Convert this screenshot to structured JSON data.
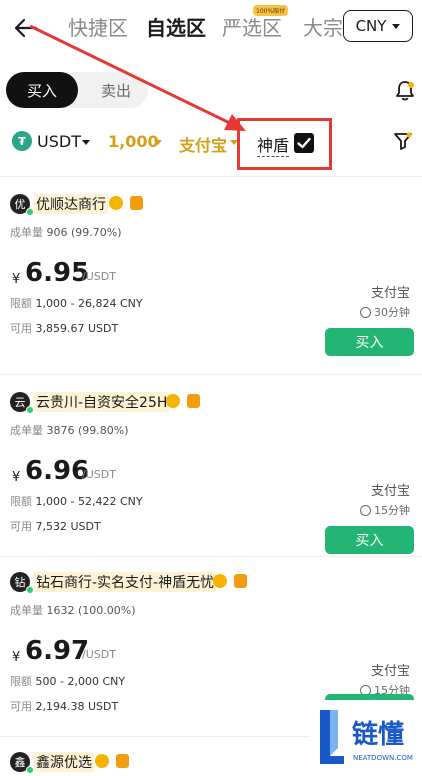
{
  "header": {
    "tabs": [
      {
        "label": "快捷区"
      },
      {
        "label": "自选区"
      },
      {
        "label": "严选区",
        "badge": "100%赔付"
      },
      {
        "label": "大宗"
      }
    ],
    "currency": "CNY"
  },
  "trade_toggle": {
    "buy": "买入",
    "sell": "卖出"
  },
  "filters": {
    "coin": "USDT",
    "amount": "1,000",
    "payment": "支付宝",
    "shield_label": "神盾",
    "shield_checked": true
  },
  "listings": [
    {
      "avatar": "优",
      "merchant": "优顺达商行",
      "orders_label": "成单量",
      "orders": "906 (99.70%)",
      "currency_symbol": "¥",
      "price": "6.95",
      "unit": "/USDT",
      "limit_label": "限额",
      "limit": "1,000 - 26,824 CNY",
      "avail_label": "可用",
      "available": "3,859.67 USDT",
      "payment": "支付宝",
      "time": "30分钟",
      "button": "买入"
    },
    {
      "avatar": "云",
      "merchant": "云贵川-自资安全25H",
      "orders_label": "成单量",
      "orders": "3876 (99.80%)",
      "currency_symbol": "¥",
      "price": "6.96",
      "unit": "/USDT",
      "limit_label": "限额",
      "limit": "1,000 - 52,422 CNY",
      "avail_label": "可用",
      "available": "7,532 USDT",
      "payment": "支付宝",
      "time": "15分钟",
      "button": "买入"
    },
    {
      "avatar": "钻",
      "merchant": "钻石商行-实名支付-神盾无忧",
      "orders_label": "成单量",
      "orders": "1632 (100.00%)",
      "currency_symbol": "¥",
      "price": "6.97",
      "unit": "/USDT",
      "limit_label": "限额",
      "limit": "500 - 2,000 CNY",
      "avail_label": "可用",
      "available": "2,194.38 USDT",
      "payment": "支付宝",
      "time": "15分钟",
      "button": "买入"
    },
    {
      "avatar": "鑫",
      "merchant": "鑫源优选"
    }
  ],
  "watermark": {
    "text": "链懂",
    "sub": "NEATDOWN.COM"
  },
  "colors": {
    "accent": "#d4a017",
    "buy": "#22b573",
    "annotation": "#e53935",
    "brand": "#1b58c7"
  }
}
